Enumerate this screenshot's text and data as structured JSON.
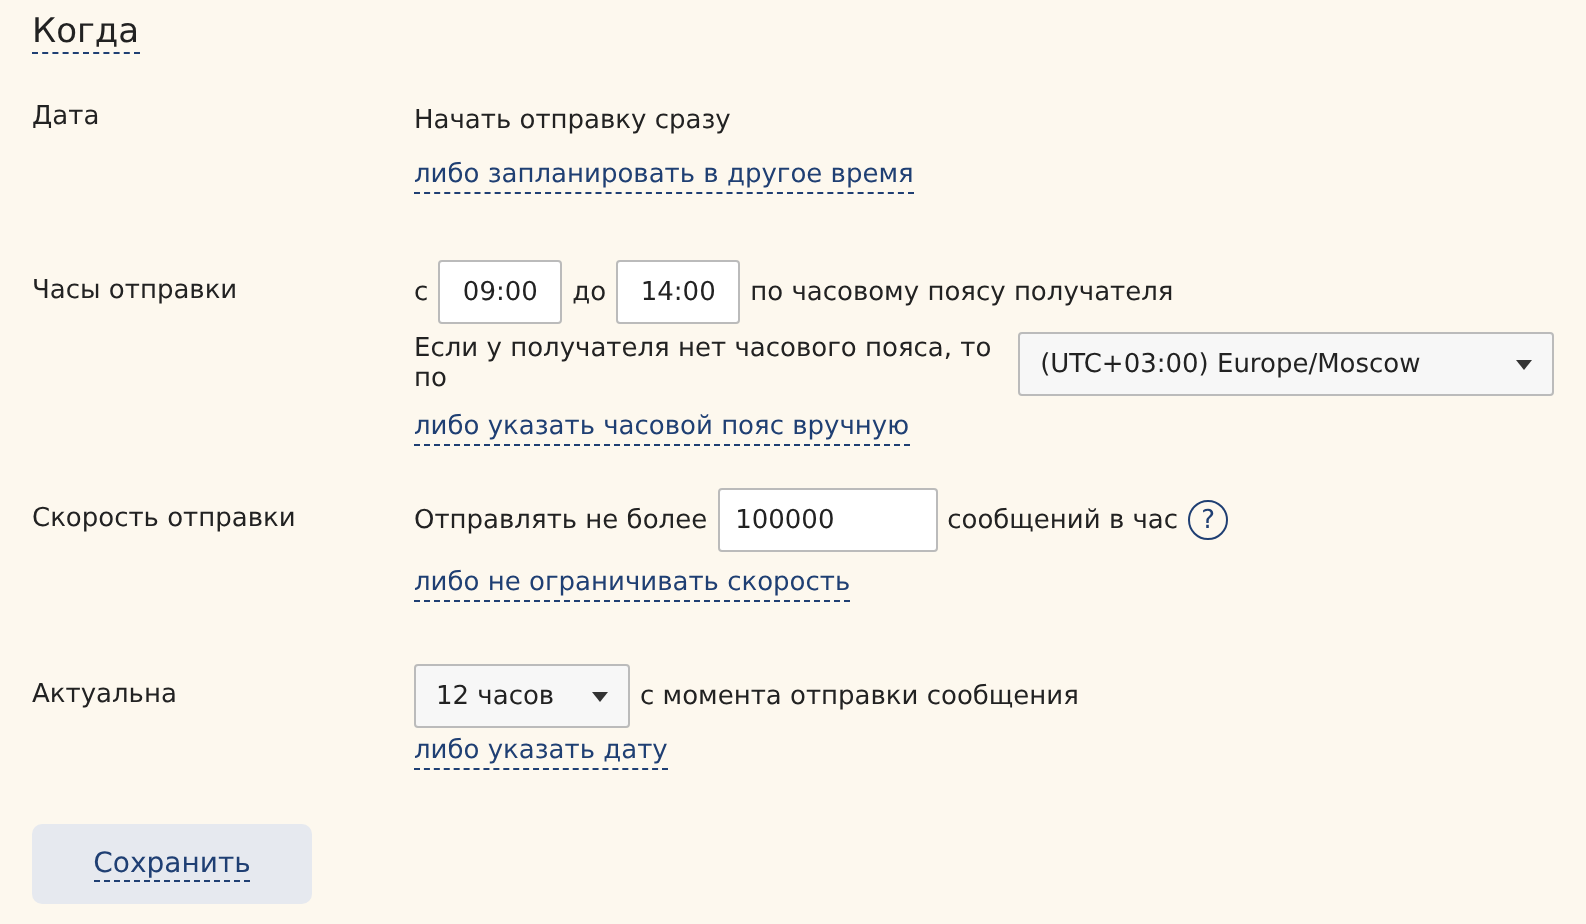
{
  "heading": "Когда",
  "date": {
    "label": "Дата",
    "text": "Начать отправку сразу",
    "link": "либо запланировать в другое время"
  },
  "hours": {
    "label": "Часы отправки",
    "from_prefix": "с",
    "from": "09:00",
    "to_prefix": "до",
    "to": "14:00",
    "suffix": "по часовому поясу получателя",
    "fallback_text": "Если у получателя нет часового пояса, то по",
    "timezone": "(UTC+03:00) Europe/Moscow",
    "link": "либо указать часовой пояс вручную"
  },
  "speed": {
    "label": "Скорость отправки",
    "prefix": "Отправлять не более",
    "value": "100000",
    "suffix": "сообщений в час",
    "help": "?",
    "link": "либо не ограничивать скорость"
  },
  "relevance": {
    "label": "Актуальна",
    "duration": "12 часов",
    "suffix": "с момента отправки сообщения",
    "link": "либо указать дату"
  },
  "save_button": "Сохранить"
}
